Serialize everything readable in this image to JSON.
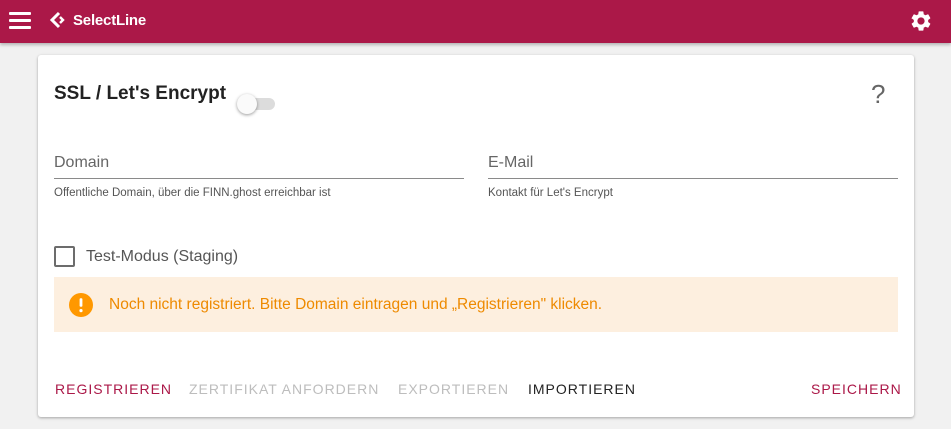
{
  "topbar": {
    "brand": "SelectLine",
    "bar_color": "#ab1848",
    "menu_icon": "hamburger-menu-icon",
    "settings_icon": "gear-icon"
  },
  "card": {
    "title": "SSL / Let's Encrypt",
    "toggle_on": false,
    "help_label": "?",
    "domain": {
      "placeholder": "Domain",
      "value": "",
      "hint": "Offentliche Domain, über die FINN.ghost erreichbar ist"
    },
    "email": {
      "placeholder": "E-Mail",
      "value": "",
      "hint": "Kontakt für Let's Encrypt"
    },
    "test_mode": {
      "label": "Test-Modus (Staging)",
      "checked": false
    },
    "alert": {
      "icon": "warning-circle-icon",
      "text": "Noch nicht registriert. Bitte Domain eintragen und „Registrieren\" klicken.",
      "text_color": "#ee8a00",
      "background": "#fdefdf"
    },
    "actions": {
      "registrieren": "Registrieren",
      "zertifikat": "Zertifikat anfordern",
      "exportieren": "Exportieren",
      "importieren": "Importieren",
      "speichern": "Speichern"
    }
  }
}
